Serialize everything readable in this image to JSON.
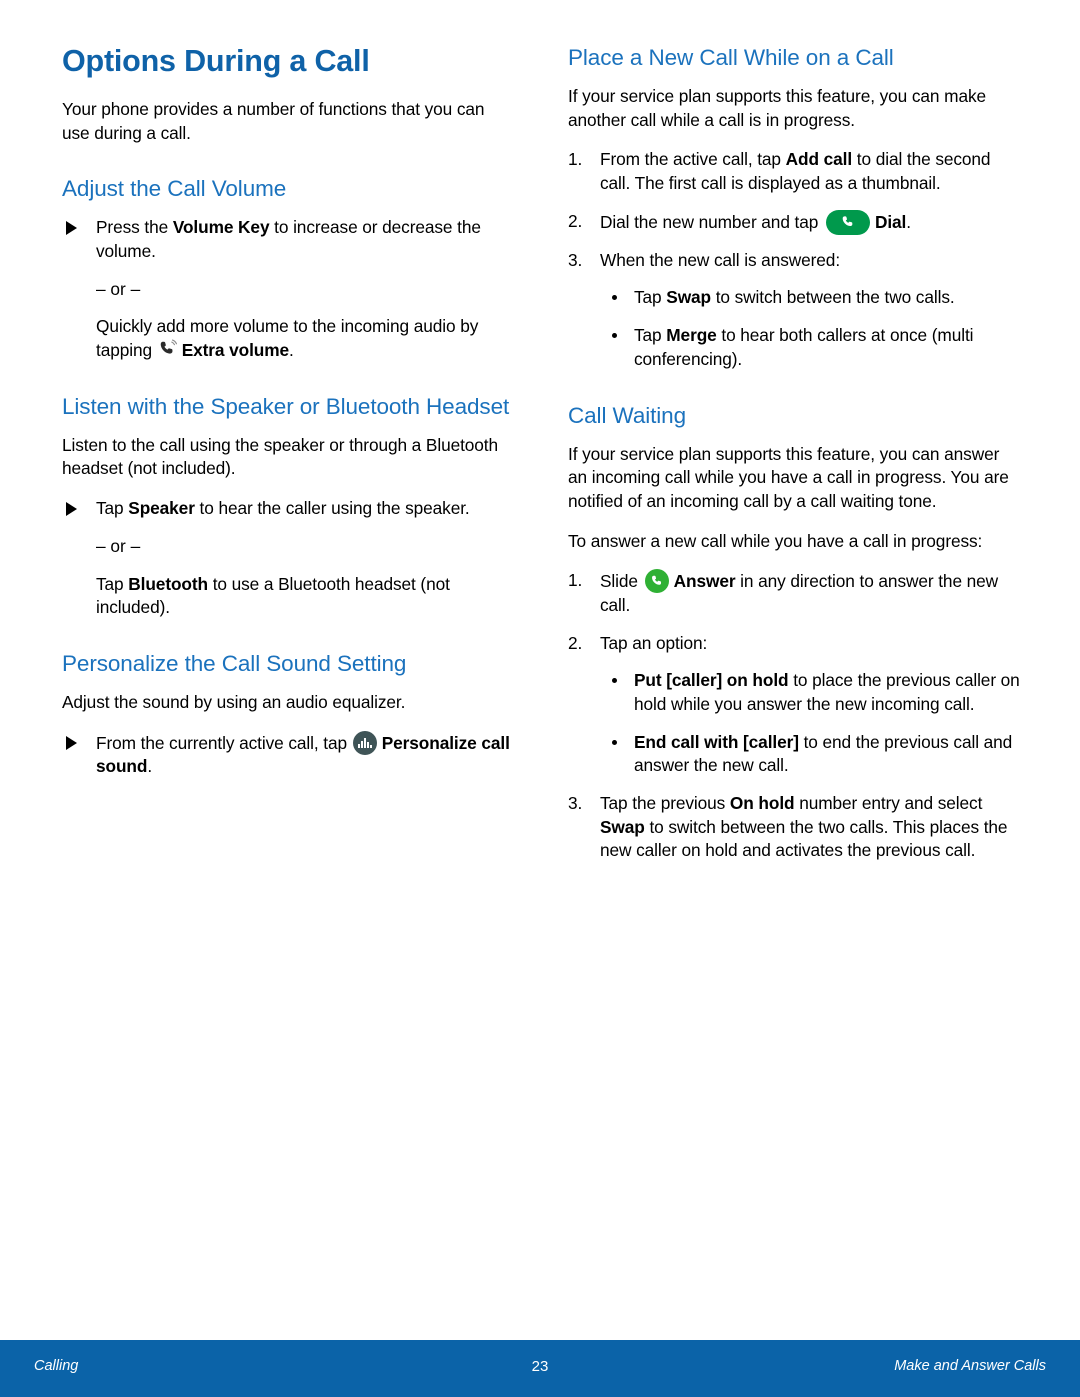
{
  "document": {
    "title": "Options During a Call"
  },
  "left_column": {
    "intro": "Your phone provides a number of functions that you can use during a call.",
    "adjust_volume": {
      "heading": "Adjust the Call Volume",
      "item1_pre": "Press the ",
      "item1_bold": "Volume Key",
      "item1_post": " to increase or decrease the volume.",
      "or": "– or –",
      "alt_pre": "Quickly add more volume to the incoming audio by tapping ",
      "alt_icon": "extra-volume-icon",
      "alt_bold": "Extra volume",
      "alt_post": "."
    },
    "speaker": {
      "heading": "Listen with the Speaker or Bluetooth Headset",
      "body": "Listen to the call using the speaker or through a Bluetooth headset (not included).",
      "item1_pre": "Tap ",
      "item1_bold": "Speaker",
      "item1_post": " to hear the caller using the speaker.",
      "or": "– or –",
      "alt_pre": "Tap ",
      "alt_bold": "Bluetooth",
      "alt_post": " to use a Bluetooth headset (not included)."
    },
    "personalize": {
      "heading": "Personalize the Call Sound Setting",
      "body": "Adjust the sound by using an audio equalizer.",
      "item1_pre": "From the currently active call, tap ",
      "item1_icon": "equalizer-icon",
      "item1_bold": "Personalize call sound",
      "item1_post": "."
    }
  },
  "right_column": {
    "new_call": {
      "heading": "Place a New Call While on a Call",
      "body": "If your service plan supports this feature, you can make another call while a call is in progress.",
      "step1": {
        "num": "1.",
        "pre": "From the active call, tap ",
        "bold": "Add call",
        "post": " to dial the second call. The first call is displayed as a thumbnail."
      },
      "step2": {
        "num": "2.",
        "pre": "Dial the new number and tap ",
        "icon": "dial-icon",
        "bold": "Dial",
        "post": "."
      },
      "step3": {
        "num": "3.",
        "text": "When the new call is answered:"
      },
      "bullets": [
        {
          "pre": "Tap ",
          "bold": "Swap",
          "post": " to switch between the two calls."
        },
        {
          "pre": "Tap ",
          "bold": "Merge",
          "post": " to hear both callers at once (multi conferencing)."
        }
      ]
    },
    "call_waiting": {
      "heading": "Call Waiting",
      "body1": "If your service plan supports this feature, you can answer an incoming call while you have a call in progress. You are notified of an incoming call by a call waiting tone.",
      "body2": "To answer a new call while you have a call in progress:",
      "step1": {
        "num": "1.",
        "pre": "Slide ",
        "icon": "answer-icon",
        "bold": "Answer",
        "post": " in any direction to answer the new call."
      },
      "step2": {
        "num": "2.",
        "text": "Tap an option:"
      },
      "bullets": [
        {
          "bold": "Put [caller] on hold",
          "post": " to place the previous caller on hold while you answer the new incoming call."
        },
        {
          "bold": "End call with [caller]",
          "post": " to end the previous call and answer the new call."
        }
      ],
      "step3": {
        "num": "3.",
        "pre": "Tap the previous ",
        "bold1": "On hold",
        "mid": " number entry and select ",
        "bold2": "Swap",
        "post": " to switch between the two calls. This places the new caller on hold and activates the previous call."
      }
    }
  },
  "footer": {
    "left": "Calling",
    "page_number": "23",
    "right": "Make and Answer Calls"
  },
  "colors": {
    "title_blue": "#0f62a8",
    "heading_blue": "#1b72bd",
    "footer_blue": "#0b63a8",
    "dial_green": "#00994c",
    "answer_green": "#2fb034",
    "equalizer_slate": "#3f5457"
  }
}
